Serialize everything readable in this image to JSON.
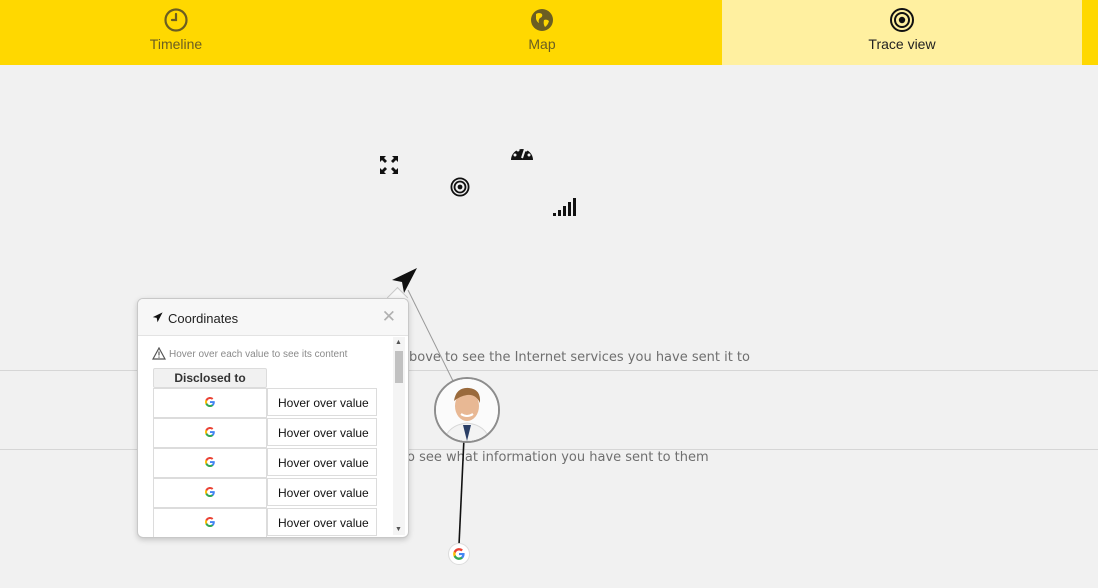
{
  "nav": {
    "tabs": [
      {
        "label": "Timeline",
        "icon": "clock-icon"
      },
      {
        "label": "Map",
        "icon": "globe-icon"
      },
      {
        "label": "Trace view",
        "icon": "target-icon",
        "active": true
      }
    ]
  },
  "canvas": {
    "hint_top": "bove to see the Internet services you have sent it to",
    "hint_bottom": "o see what information you have sent to them",
    "floating_icons": [
      "expand-arrows-icon",
      "dashboard-gauge-icon",
      "target-icon",
      "signal-bars-icon",
      "location-arrow-icon"
    ],
    "nodes": [
      "user-avatar",
      "google-node-icon"
    ]
  },
  "popup": {
    "title": "Coordinates",
    "title_icon": "location-arrow-icon",
    "warning": "Hover over each value to see its content",
    "column_header": "Disclosed to",
    "rows": [
      {
        "service_icon": "google-icon",
        "value": "Hover over value"
      },
      {
        "service_icon": "google-icon",
        "value": "Hover over value"
      },
      {
        "service_icon": "google-icon",
        "value": "Hover over value"
      },
      {
        "service_icon": "google-icon",
        "value": "Hover over value"
      },
      {
        "service_icon": "google-icon",
        "value": "Hover over value"
      }
    ]
  },
  "colors": {
    "topbar": "#ffd800",
    "active_tab": "#fff0a0",
    "background": "#f1f1f1"
  }
}
